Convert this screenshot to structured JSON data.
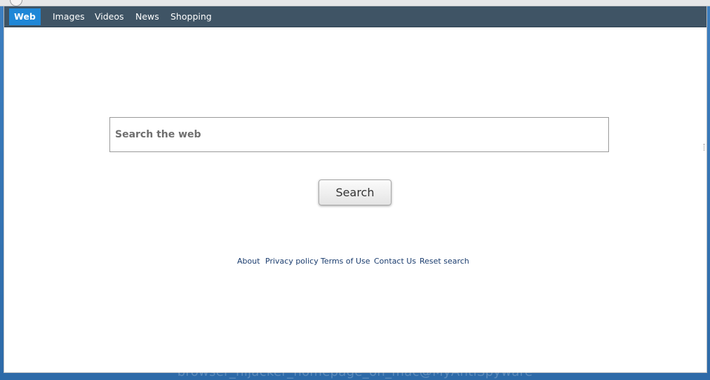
{
  "nav": {
    "items": [
      {
        "label": "Web",
        "active": true
      },
      {
        "label": "Images",
        "active": false
      },
      {
        "label": "Videos",
        "active": false
      },
      {
        "label": "News",
        "active": false
      },
      {
        "label": "Shopping",
        "active": false
      }
    ]
  },
  "search": {
    "placeholder": "Search the web",
    "value": "",
    "button_label": "Search"
  },
  "footer": {
    "links": [
      "About",
      "Privacy policy",
      "Terms of Use",
      "Contact Us",
      "Reset search"
    ]
  },
  "watermark": "browser_hijacker_homepage_on_mac@MyAntiSpyware",
  "colors": {
    "navbar_bg": "#3f5465",
    "nav_active_bg": "#1f87d7",
    "link": "#1a3c6e",
    "desktop_bg": "#2d6aa8"
  }
}
